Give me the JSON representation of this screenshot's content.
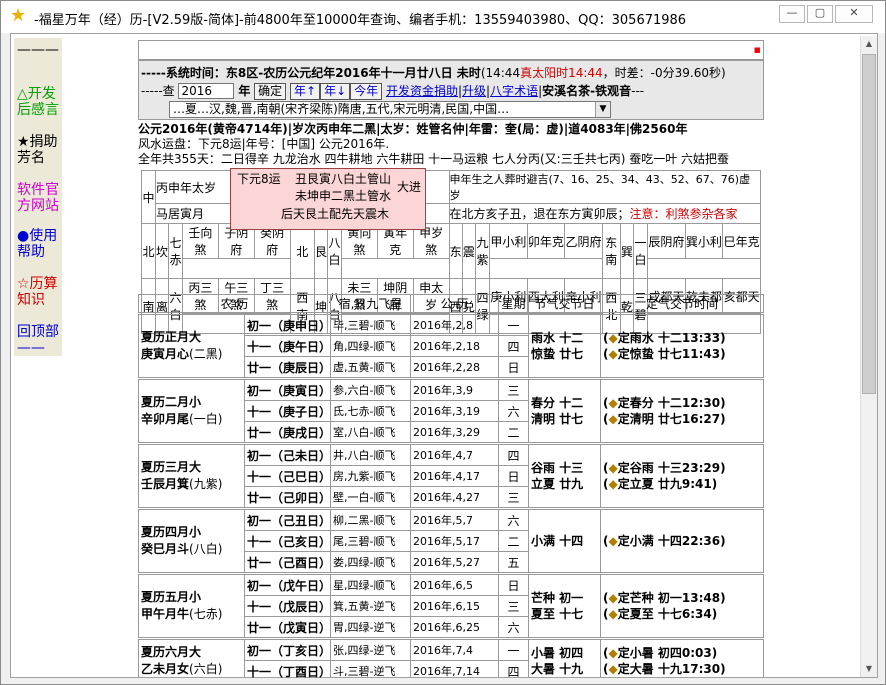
{
  "window": {
    "title": "-福星万年（经）历-[V2.59版-简体]-前4800年至10000年查询、编者手机：13559403980、QQ：305671986"
  },
  "nav": [
    {
      "label": "——",
      "color": "#000"
    },
    {
      "label": "△开发后感言",
      "color": "#00a000"
    },
    {
      "label": "★捐助芳名",
      "color": "#000"
    },
    {
      "label": "软件官方网站",
      "color": "#d000d0"
    },
    {
      "label": "●使用帮助",
      "color": "#0000d0"
    },
    {
      "label": "☆历算知识",
      "color": "#d00000"
    },
    {
      "label": "回顶部——",
      "color": "#0000d0"
    }
  ],
  "sys": {
    "line1_a": "-----系统时间：东8区-农历公元纪年2016年十一月廿八日 未时",
    "line1_b": "(14:44",
    "line1_c": "真太阳时14:44",
    "line1_d": "，时差：-0分39.60秒)",
    "query_prefix": "-----查",
    "year_value": "2016",
    "year_unit": "年",
    "confirm": "确定",
    "year_up": "年↑",
    "year_down": "年↓",
    "this_year": "今年",
    "donate": "开发资金捐助",
    "upgrade": "升级",
    "terms": "八字术语",
    "ad": "安溪名茶-铁观音",
    "dash": "---",
    "dynasty": "…夏…汉,魏,晋,南朝(宋齐梁陈)隋唐,五代,宋元明清,民国,中国…"
  },
  "info": {
    "line1": "公元2016年(黄帝4714年)|岁次丙申年二黑|太岁：姓管名仲|年雷：奎(局：虚)|道4083年|佛2560年",
    "line2": "风水运盘：下元8运|年号：[中国] 公元2016年.",
    "line3": "全年共355天：二日得辛 九龙治水 四牛耕地 六牛耕田 十一马运粮 七人分丙(又:三壬共七丙) 蚕吃一叶 六姑把蚕"
  },
  "popup": {
    "l1": "下元8运",
    "l2a": "丑艮寅八白土管山",
    "l2b": "大进",
    "l3": "未坤申二黑土管水",
    "l4": "后天艮土配先天震木"
  },
  "palace": {
    "row1": [
      "中",
      "丙申年太岁",
      "",
      "申年生之人葬时避吉(7、16、25、34、43、52、67、76)虚岁"
    ],
    "row2": "马居寅月",
    "row2b": "在北方亥子丑，退在东方寅卯辰；",
    "row2c": "注意：利煞参杂各家",
    "grid1": [
      "北",
      "坎",
      "七赤",
      "壬向煞",
      "子阴府",
      "癸阴府",
      "北",
      "艮",
      "八白",
      "黄向煞",
      "寅年克",
      "甲岁煞",
      "东",
      "震",
      "九紫",
      "甲小利",
      "卯年克",
      "乙阴府",
      "东南",
      "巽",
      "一白",
      "辰阴府",
      "巽小利",
      "巳年克"
    ],
    "grid2": [
      "南",
      "离",
      "六白",
      "丙三煞",
      "午三煞",
      "丁三煞",
      "西南",
      "坤",
      "八白",
      "未三煞",
      "坤阴府",
      "申太岁",
      "西",
      "兑",
      "四绿",
      "庚小利",
      "酉大利",
      "辛小利",
      "西北",
      "乾",
      "三碧",
      "戌都天",
      "乾夫都",
      "亥都天"
    ]
  },
  "cal": {
    "headers": [
      "农 历",
      "宿,日九飞星",
      "公 历",
      "星期",
      "节气交节日",
      "定气交节时间"
    ],
    "months": [
      {
        "name": "夏历正月大",
        "gz": "庚寅月心",
        "star": "(二黑)",
        "days": [
          [
            "初一（庚申日）",
            "毕,三碧-顺飞",
            "2016年,2,8",
            "一"
          ],
          [
            "十一（庚午日）",
            "角,四绿-顺飞",
            "2016年,2,18",
            "四"
          ],
          [
            "廿一（庚辰日）",
            "虚,五黄-顺飞",
            "2016年,2,28",
            "日"
          ]
        ],
        "jq": "雨水 十二\n惊蛰 廿七",
        "dq": [
          "定雨水 十二13:33",
          "定惊蛰 廿七11:43"
        ]
      },
      {
        "name": "夏历二月小",
        "gz": "辛卯月尾",
        "star": "(一白)",
        "days": [
          [
            "初一（庚寅日）",
            "参,六白-顺飞",
            "2016年,3,9",
            "三"
          ],
          [
            "十一（庚子日）",
            "氐,七赤-顺飞",
            "2016年,3,19",
            "六"
          ],
          [
            "廿一（庚戌日）",
            "室,八白-顺飞",
            "2016年,3,29",
            "二"
          ]
        ],
        "jq": "春分 十二\n清明 廿七",
        "dq": [
          "定春分 十二12:30",
          "定清明 廿七16:27"
        ]
      },
      {
        "name": "夏历三月大",
        "gz": "壬辰月箕",
        "star": "(九紫)",
        "days": [
          [
            "初一（己未日）",
            "井,八白-顺飞",
            "2016年,4,7",
            "四"
          ],
          [
            "十一（己巳日）",
            "房,九紫-顺飞",
            "2016年,4,17",
            "日"
          ],
          [
            "廿一（己卯日）",
            "壁,一白-顺飞",
            "2016年,4,27",
            "三"
          ]
        ],
        "jq": "谷雨 十三\n立夏 廿九",
        "dq": [
          "定谷雨 十三23:29",
          "定立夏 廿九9:41"
        ]
      },
      {
        "name": "夏历四月小",
        "gz": "癸巳月斗",
        "star": "(八白)",
        "days": [
          [
            "初一（己丑日）",
            "柳,二黑-顺飞",
            "2016年,5,7",
            "六"
          ],
          [
            "十一（己亥日）",
            "尾,三碧-顺飞",
            "2016年,5,17",
            "二"
          ],
          [
            "廿一（己酉日）",
            "娄,四绿-顺飞",
            "2016年,5,27",
            "五"
          ]
        ],
        "jq": "小满 十四",
        "dq": [
          "定小满 十四22:36"
        ]
      },
      {
        "name": "夏历五月小",
        "gz": "甲午月牛",
        "star": "(七赤)",
        "days": [
          [
            "初一（戊午日）",
            "星,四绿-顺飞",
            "2016年,6,5",
            "日"
          ],
          [
            "十一（戊辰日）",
            "箕,五黄-逆飞",
            "2016年,6,15",
            "三"
          ],
          [
            "廿一（戊寅日）",
            "胃,四绿-逆飞",
            "2016年,6,25",
            "六"
          ]
        ],
        "jq": "芒种 初一\n夏至 十七",
        "dq": [
          "定芒种 初一13:48",
          "定夏至 十七6:34"
        ]
      },
      {
        "name": "夏历六月大",
        "gz": "乙未月女",
        "star": "(六白)",
        "days": [
          [
            "初一（丁亥日）",
            "张,四绿-逆飞",
            "2016年,7,4",
            "一"
          ],
          [
            "十一（丁酉日）",
            "斗,三碧-逆飞",
            "2016年,7,14",
            "四"
          ]
        ],
        "jq": "小暑 初四\n大暑 十九",
        "dq": [
          "定小暑 初四0:03",
          "定大暑 十九17:30"
        ]
      }
    ]
  }
}
